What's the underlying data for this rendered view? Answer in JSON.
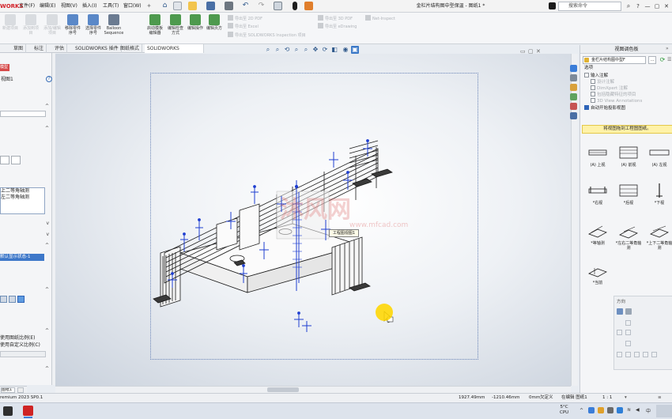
{
  "titlebar": {
    "logo": "WORKS",
    "menus": [
      "文件(F)",
      "编辑(E)",
      "视图(V)",
      "插入(I)",
      "工具(T)",
      "窗口(W)"
    ],
    "title": "金栏片结构图中型保温 - 图纸1 *",
    "search_placeholder": "搜索命令",
    "minimize": "—",
    "restore": "▢",
    "close": "✕",
    "help": "?"
  },
  "ribbon": {
    "buttons": [
      {
        "label": "新建项目"
      },
      {
        "label": "添加到项目"
      },
      {
        "label": "添加/编辑项目"
      },
      {
        "label": "移除零件序号"
      },
      {
        "label": "选择零件序号"
      },
      {
        "label": "Balloon Sequence"
      },
      {
        "label": "启动模板编辑器"
      },
      {
        "label": "编辑检查方式"
      },
      {
        "label": "编辑操作"
      },
      {
        "label": "编辑页方"
      }
    ],
    "export_items": [
      "导出至 2D PDF",
      "导出至 Excel",
      "导出至 SOLIDWORKS Inspection 项目",
      "导出至 3D PDF",
      "导出至 eDrawing",
      "Net-Inspect"
    ]
  },
  "tabs": [
    {
      "label": "草图"
    },
    {
      "label": "标注"
    },
    {
      "label": "评估"
    },
    {
      "label": "SOLIDWORKS 插件"
    },
    {
      "label": "图纸格式"
    },
    {
      "label": "SOLIDWORKS Inspection",
      "active": true
    }
  ],
  "leftpanel": {
    "header": "模型视图",
    "subtitle": "视图1",
    "help": "?",
    "items": [
      "上二等角轴测",
      "左二等角轴测"
    ],
    "selected": "默认显示状态-1",
    "scale_options": [
      "使用图纸比例(E)",
      "使用自定义比例(C)"
    ]
  },
  "canvas": {
    "tooltip": "工程图视图1",
    "watermark": "沐风网",
    "watermark_url": "www.mfcad.com"
  },
  "rightpanel": {
    "header": "视图调色板",
    "select_value": "金栏片结构图中型F",
    "ellipsis": "...",
    "options_label": "选项",
    "options": [
      {
        "label": "输入注解",
        "checked": false,
        "dim": false
      },
      {
        "label": "设计注解",
        "checked": false,
        "dim": true
      },
      {
        "label": "DimXpert 注解",
        "checked": false,
        "dim": true
      },
      {
        "label": "包括隐藏特征的项目",
        "checked": false,
        "dim": true
      },
      {
        "label": "3D View Annotations",
        "checked": false,
        "dim": true
      },
      {
        "label": "自动开始投影视图",
        "checked": true,
        "dim": false
      }
    ],
    "drag_hint": "将视图拖到工程图图纸。",
    "views": [
      {
        "label": "(A) 上视"
      },
      {
        "label": "(A) 前视"
      },
      {
        "label": "(A) 左视"
      },
      {
        "label": "*右视"
      },
      {
        "label": "*后视"
      },
      {
        "label": "*下视"
      },
      {
        "label": "*等轴测"
      },
      {
        "label": "*左右二等角轴测"
      },
      {
        "label": "*上下二等角轴测"
      },
      {
        "label": "*当前"
      }
    ],
    "direction_label": "方向"
  },
  "statusbar": {
    "version": "remium 2023 SP0.1",
    "x": "1927.49mm",
    "y": "-1210.46mm",
    "z": "0mm",
    "state": "欠定义",
    "editing": "在编辑 图纸1",
    "scale": "1 : 1"
  },
  "taskbar": {
    "temp": "5°C",
    "cpu": "CPU",
    "lang": "中",
    "time": "",
    "date": ""
  },
  "colors": {
    "accent": "#2e64b8",
    "drag_hint_bg": "#fff2a8",
    "cursor_highlight": "#ffd600",
    "dimension_blue": "#1f3fd1"
  }
}
